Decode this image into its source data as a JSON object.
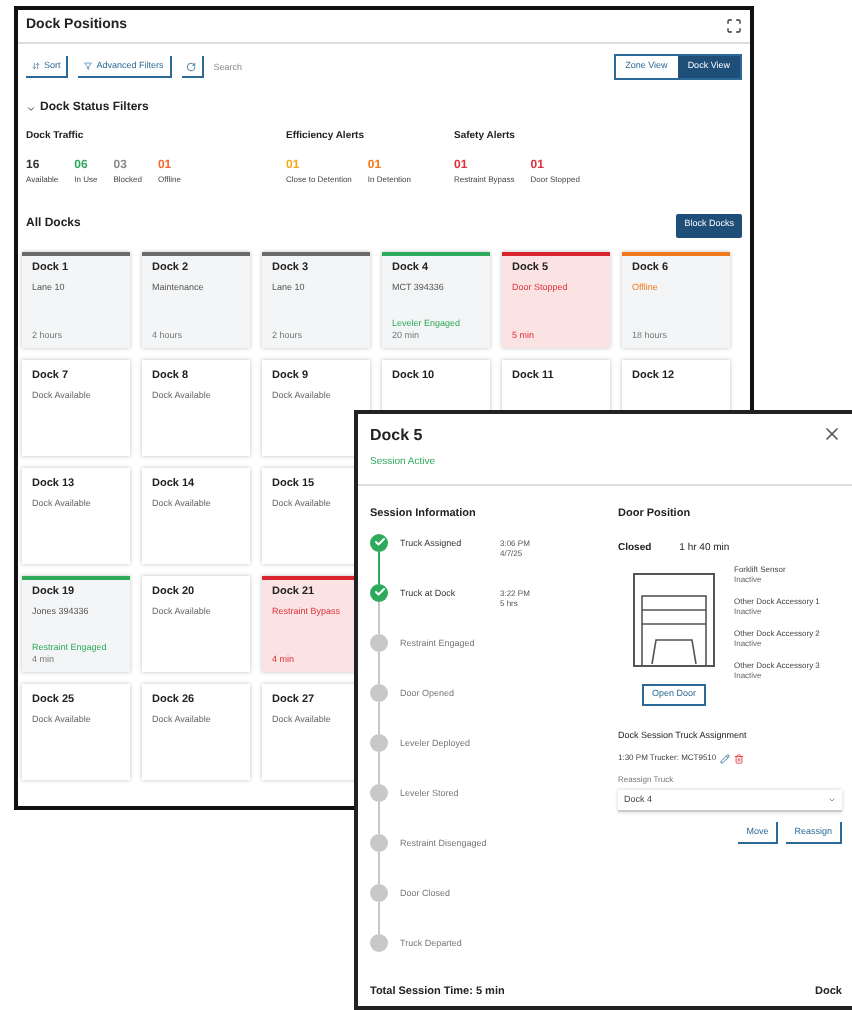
{
  "main": {
    "title": "Dock Positions",
    "toolbar": {
      "sort": "Sort",
      "advanced_filters": "Advanced Filters",
      "search_placeholder": "Search"
    },
    "views": [
      {
        "label": "Zone View",
        "selected": false
      },
      {
        "label": "Dock View",
        "selected": true
      }
    ],
    "filters": {
      "title": "Dock Status Filters",
      "expanded": true,
      "groups": [
        {
          "title": "Dock Traffic",
          "items": [
            {
              "count": "16",
              "label": "Available",
              "color": "#333333"
            },
            {
              "count": "06",
              "label": "In Use",
              "color": "#2eaa5c"
            },
            {
              "count": "03",
              "label": "Blocked",
              "color": "#8a8a8a"
            },
            {
              "count": "01",
              "label": "Offline",
              "color": "#ef6a33"
            }
          ]
        },
        {
          "title": "Efficiency Alerts",
          "items": [
            {
              "count": "01",
              "label": "Close to Detention",
              "color": "#f2a91c"
            },
            {
              "count": "01",
              "label": "In Detention",
              "color": "#f07a1e"
            }
          ]
        },
        {
          "title": "Safety Alerts",
          "items": [
            {
              "count": "01",
              "label": "Restraint Bypass",
              "color": "#e0303a"
            },
            {
              "count": "01",
              "label": "Door Stopped",
              "color": "#e0303a"
            }
          ]
        }
      ]
    },
    "all_docks": {
      "title": "All Docks",
      "block_button": "Block Docks",
      "docks": [
        {
          "name": "Dock 1",
          "kind": "idle",
          "detail": "Lane 10",
          "time": "2 hours"
        },
        {
          "name": "Dock 2",
          "kind": "idle",
          "detail": "Maintenance",
          "time": "4 hours"
        },
        {
          "name": "Dock 3",
          "kind": "idle",
          "detail": "Lane 10",
          "time": "2 hours"
        },
        {
          "name": "Dock 4",
          "kind": "engaged",
          "detail": "MCT 394336",
          "note": "Leveler Engaged",
          "time": "20 min"
        },
        {
          "name": "Dock 5",
          "kind": "alert",
          "detail": "Door Stopped",
          "time": "5 min"
        },
        {
          "name": "Dock 6",
          "kind": "offline",
          "detail": "Offline",
          "time": "18 hours"
        },
        {
          "name": "Dock 7",
          "kind": "available",
          "detail": "Dock Available"
        },
        {
          "name": "Dock 8",
          "kind": "available",
          "detail": "Dock Available"
        },
        {
          "name": "Dock 9",
          "kind": "available",
          "detail": "Dock Available"
        },
        {
          "name": "Dock 10",
          "kind": "available"
        },
        {
          "name": "Dock 11",
          "kind": "available"
        },
        {
          "name": "Dock 12",
          "kind": "available"
        },
        {
          "name": "Dock 13",
          "kind": "available",
          "detail": "Dock Available"
        },
        {
          "name": "Dock 14",
          "kind": "available",
          "detail": "Dock Available"
        },
        {
          "name": "Dock 15",
          "kind": "available",
          "detail": "Dock Available"
        },
        {
          "name": "Dock 19",
          "kind": "engaged",
          "detail": "Jones 394336",
          "note": "Restraint Engaged",
          "time": "4 min"
        },
        {
          "name": "Dock 20",
          "kind": "available",
          "detail": "Dock Available"
        },
        {
          "name": "Dock 21",
          "kind": "alert",
          "detail": "Restraint Bypass",
          "time": "4 min"
        },
        {
          "name": "Dock 25",
          "kind": "available",
          "detail": "Dock Available"
        },
        {
          "name": "Dock 26",
          "kind": "available",
          "detail": "Dock Available"
        },
        {
          "name": "Dock 27",
          "kind": "available",
          "detail": "Dock Available"
        }
      ]
    }
  },
  "modal": {
    "title": "Dock 5",
    "status": "Session Active",
    "session": {
      "title": "Session Information",
      "steps": [
        {
          "label": "Truck Assigned",
          "done": true,
          "time": "3:06 PM",
          "date": "4/7/25"
        },
        {
          "label": "Truck at Dock",
          "done": true,
          "time": "3:22 PM",
          "date": "5 hrs"
        },
        {
          "label": "Restraint Engaged",
          "done": false
        },
        {
          "label": "Door Opened",
          "done": false
        },
        {
          "label": "Leveler Deployed",
          "done": false
        },
        {
          "label": "Leveler Stored",
          "done": false
        },
        {
          "label": "Restraint Disengaged",
          "done": false
        },
        {
          "label": "Door Closed",
          "done": false
        },
        {
          "label": "Truck Departed",
          "done": false
        }
      ]
    },
    "door": {
      "title": "Door Position",
      "state": "Closed",
      "duration": "1 hr 40 min",
      "open_button": "Open Door",
      "sensors": [
        {
          "name": "Forklift Sensor",
          "state": "Inactive"
        },
        {
          "name": "Other Dock Accessory 1",
          "state": "Inactive"
        },
        {
          "name": "Other Dock Accessory 2",
          "state": "Inactive"
        },
        {
          "name": "Other Dock Accessory 3",
          "state": "Inactive"
        }
      ]
    },
    "assignment": {
      "title": "Dock Session Truck Assignment",
      "value": "1:30 PM Trucker: MCT9510",
      "reassign_label": "Reassign Truck",
      "select_value": "Dock 4",
      "buttons": [
        "Move",
        "Reassign"
      ]
    },
    "footer": {
      "total": "Total Session Time: 5 min",
      "dock": "Dock"
    }
  }
}
